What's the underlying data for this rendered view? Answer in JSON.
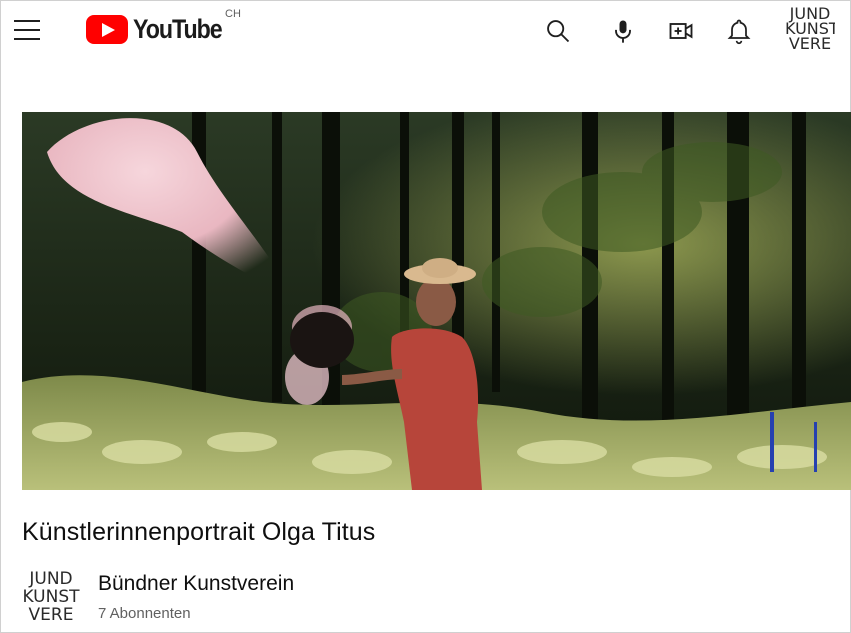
{
  "header": {
    "logo_text": "YouTube",
    "country_code": "CH",
    "icons": [
      "menu-icon",
      "search-icon",
      "microphone-icon",
      "create-video-icon",
      "bell-icon"
    ],
    "account_avatar_lines": [
      "JUND",
      "KUNST",
      "VERE"
    ]
  },
  "video": {
    "title": "Künstlerinnenportrait Olga Titus"
  },
  "channel": {
    "name": "Bündner Kunstverein",
    "subscribers": "7 Abonnenten",
    "avatar_lines": [
      "JUND",
      "KUNST",
      "VERE"
    ]
  },
  "colors": {
    "brand_red": "#ff0000",
    "text_primary": "#0f0f0f",
    "text_secondary": "#606060"
  }
}
